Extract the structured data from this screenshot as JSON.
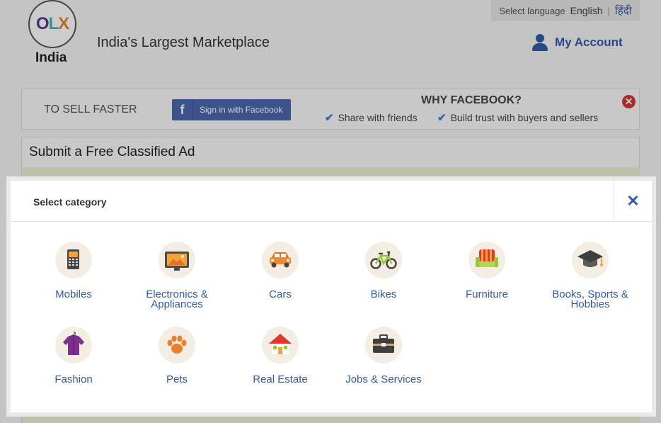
{
  "header": {
    "logo": {
      "o": "O",
      "l": "L",
      "x": "X"
    },
    "country": "India",
    "tagline": "India's Largest Marketplace",
    "language": {
      "prompt": "Select language",
      "english": "English",
      "separator": "|",
      "hindi": "हिंदी"
    },
    "account_label": "My Account"
  },
  "facebook_bar": {
    "sell_text": "TO SELL FASTER",
    "button_icon": "f",
    "button_label": "Sign in with Facebook",
    "why_title": "WHY FACEBOOK?",
    "perks": [
      "Share with friends",
      "Build trust with buyers and sellers"
    ],
    "close_symbol": "✕"
  },
  "ad_form": {
    "title": "Submit a Free Classified Ad"
  },
  "modal": {
    "title": "Select category",
    "close_symbol": "✕",
    "categories": [
      {
        "label": "Mobiles",
        "icon": "mobile-phone-icon"
      },
      {
        "label": "Electronics & Appliances",
        "icon": "tv-icon"
      },
      {
        "label": "Cars",
        "icon": "car-icon"
      },
      {
        "label": "Bikes",
        "icon": "bicycle-icon"
      },
      {
        "label": "Furniture",
        "icon": "sofa-icon"
      },
      {
        "label": "Books, Sports & Hobbies",
        "icon": "graduation-cap-icon"
      },
      {
        "label": "Fashion",
        "icon": "shirt-icon"
      },
      {
        "label": "Pets",
        "icon": "paw-icon"
      },
      {
        "label": "Real Estate",
        "icon": "house-icon"
      },
      {
        "label": "Jobs & Services",
        "icon": "briefcase-icon"
      }
    ]
  },
  "colors": {
    "link_blue": "#2f5aa8",
    "facebook_blue": "#4a67ad",
    "close_red": "#d63637",
    "icon_circle": "#f3ede3"
  }
}
